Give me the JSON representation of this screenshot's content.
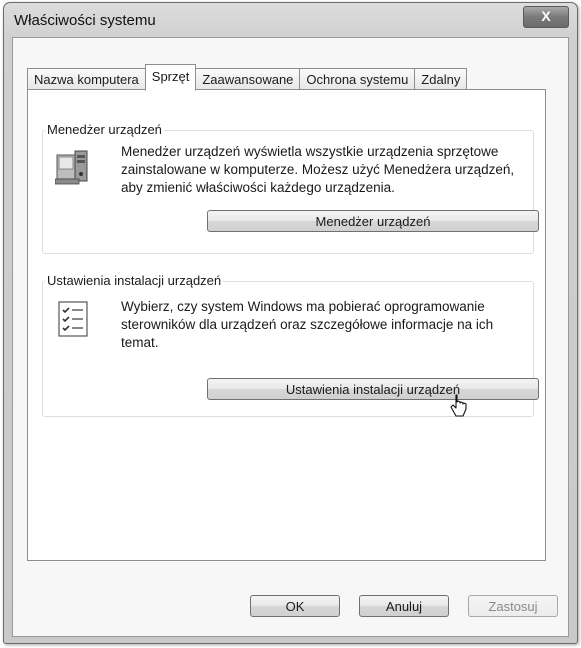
{
  "window": {
    "title": "Właściwości systemu",
    "close_label": "X"
  },
  "tabs": [
    {
      "label": "Nazwa komputera",
      "active": false
    },
    {
      "label": "Sprzęt",
      "active": true
    },
    {
      "label": "Zaawansowane",
      "active": false
    },
    {
      "label": "Ochrona systemu",
      "active": false
    },
    {
      "label": "Zdalny",
      "active": false
    }
  ],
  "device_manager": {
    "title": "Menedżer urządzeń",
    "description": "Menedżer urządzeń wyświetla wszystkie urządzenia sprzętowe zainstalowane w komputerze. Możesz użyć Menedżera urządzeń, aby zmienić właściwości każdego urządzenia.",
    "button_label": "Menedżer urządzeń",
    "icon": "device-manager-icon"
  },
  "device_installation": {
    "title": "Ustawienia instalacji urządzeń",
    "description": "Wybierz, czy system Windows ma pobierać oprogramowanie sterowników dla urządzeń oraz szczegółowe informacje na ich temat.",
    "button_label": "Ustawienia instalacji urządzeń",
    "icon": "checklist-icon"
  },
  "footer": {
    "ok_label": "OK",
    "cancel_label": "Anuluj",
    "apply_label": "Zastosuj"
  }
}
